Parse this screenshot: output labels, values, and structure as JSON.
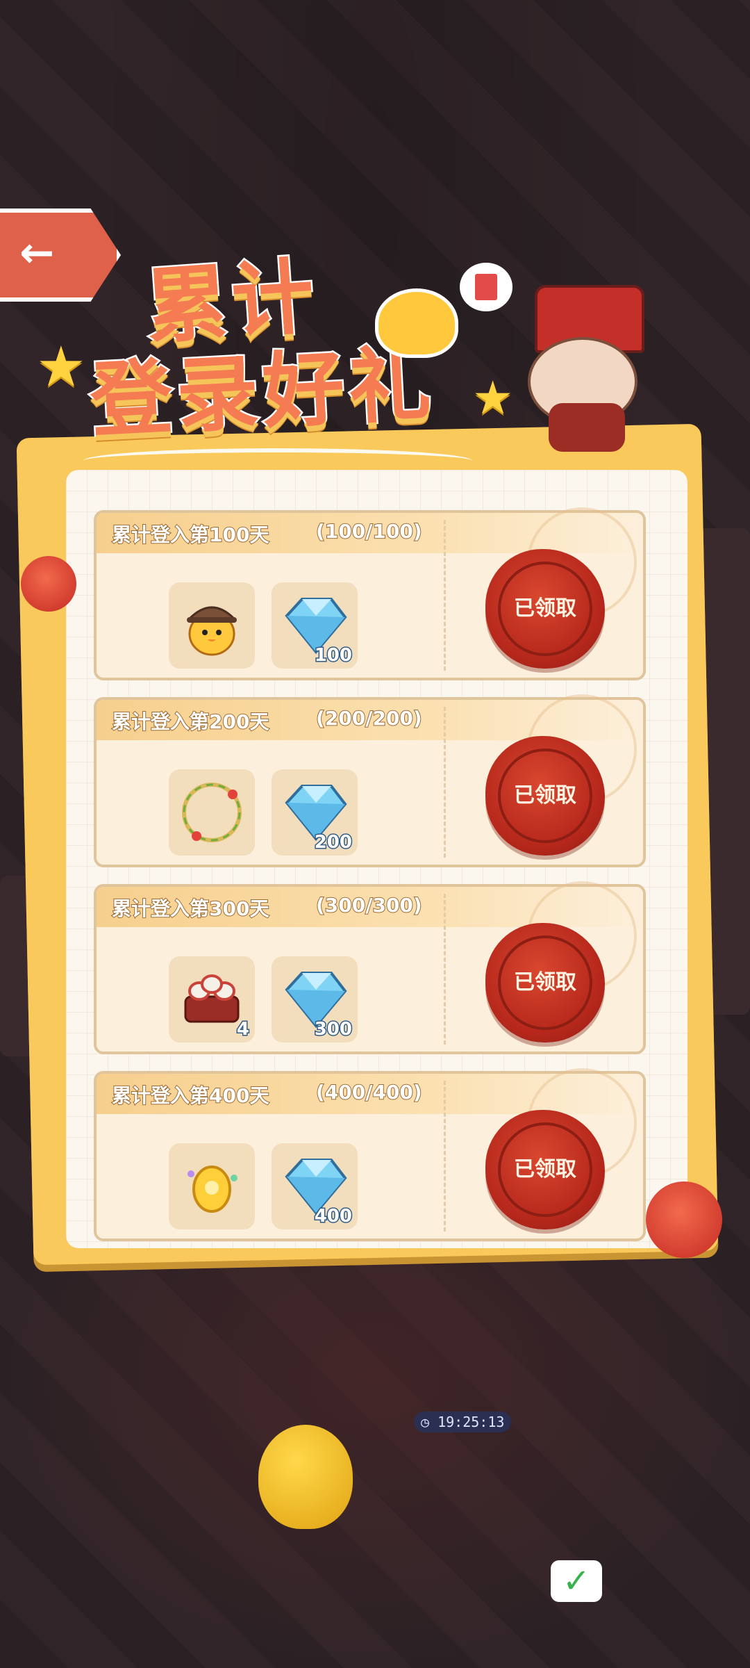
{
  "header": {
    "back_icon": "arrow-left-icon",
    "title_line1": "累计",
    "title_line2": "登录好礼",
    "bubble_icon": "book-icon"
  },
  "rewards": [
    {
      "title": "累计登入第100天",
      "progress": "(100/100)",
      "items": [
        {
          "icon": "duck-detective-avatar-icon",
          "qty": ""
        },
        {
          "icon": "diamond-icon",
          "qty": "100"
        }
      ],
      "status": "已领取"
    },
    {
      "title": "累计登入第200天",
      "progress": "(200/200)",
      "items": [
        {
          "icon": "flower-wreath-frame-icon",
          "qty": ""
        },
        {
          "icon": "diamond-icon",
          "qty": "200"
        }
      ],
      "status": "已领取"
    },
    {
      "title": "累计登入第300天",
      "progress": "(300/300)",
      "items": [
        {
          "icon": "sushi-box-icon",
          "qty": "4"
        },
        {
          "icon": "diamond-icon",
          "qty": "300"
        }
      ],
      "status": "已领取"
    },
    {
      "title": "累计登入第400天",
      "progress": "(400/400)",
      "items": [
        {
          "icon": "golden-egg-icon",
          "qty": ""
        },
        {
          "icon": "diamond-icon",
          "qty": "400"
        }
      ],
      "status": "已领取"
    }
  ],
  "scene": {
    "timer": "19:25:13",
    "timer_icon": "clock-icon",
    "check_icon": "checkmark-icon"
  },
  "colors": {
    "title": "#f47b52",
    "seal": "#b5271b",
    "card": "#fcf0dc",
    "panel_frame": "#f9c95b",
    "diamond": "#7fd3f5"
  }
}
